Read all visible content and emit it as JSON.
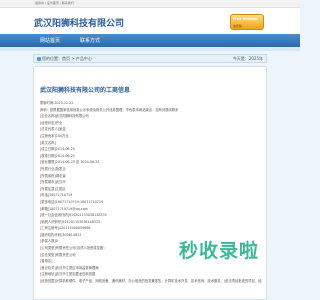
{
  "topbar": {
    "links": "加载中 | 设为首页 | 联系我们"
  },
  "header": {
    "company_name": "武汉阳狮科技有限公司",
    "badge_top": "Free Version",
    "badge_bottom": "免费版"
  },
  "nav": {
    "home": "网站首页",
    "contact": "联系方式"
  },
  "breadcrumb": {
    "left": "您的位置：首页 > 产品中心",
    "right": "今天是：2025年"
  },
  "content": {
    "title": "武汉阳狮科技有限公司的工商信息",
    "lines": [
      "更新时间:2025-12-22",
      "声明：是根据国家信用信息公示系统及相关公开信息整理，不代表本网站观点，如有问题请联系",
      "[企业名称]武汉阳狮科技有限公司",
      "[经营状态]开业",
      "[法定代表人]吴金",
      "[注册资本]100万元",
      "[英文名称]",
      "[成立日期]2014-06-25",
      "[核准日期]2014-06-25",
      "[营业期限]2014-06-25 至 2034-06-24",
      "[所属行业]批发业",
      "[所属省份]湖北省",
      "[所属城市]武汉市",
      "[所属区县]江夏区",
      "[电话]18071710719",
      "[更多电话]18071710719;18071710719",
      "[邮箱]18071710719@qq.com",
      "[统一社会信用代码]914201153036148335",
      "[纳税人识别号]914201153036148335",
      "[工商注册号]420115000059666",
      "[组织机构代码]303614833",
      "[参保人数]0",
      "[公司类型]有限责任公司(自然人投资或控股)",
      "[企业类型]有限责任公司",
      "[曾用名]",
      "[登记机关]武汉市江夏区市场监督管理局",
      "[注册地址]武汉市江夏区藏龙岛科技园",
      "[经营范围]计算机软硬件、电子产品、网络设备、通讯器材、办公用品的批发兼零售；计算机技术开发、技术咨询、技术服务。(依法须经批准的项目，经相关部门批准后方可开展经营活动)"
    ]
  },
  "watermark": "秒收录啦"
}
